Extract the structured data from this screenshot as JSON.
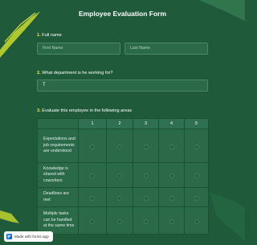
{
  "form": {
    "title": "Employee Evaluation Form",
    "accent_color": "#f1ec2f",
    "background_color": "#1f5a3b"
  },
  "questions": {
    "q1": {
      "number": "1.",
      "label": "Full name",
      "first_placeholder": "First Name",
      "last_placeholder": "Last Name"
    },
    "q2": {
      "number": "2.",
      "label": "What department is he working for?",
      "value": "T"
    },
    "q3": {
      "number": "3.",
      "label": "Evaluate this employee in the following areas",
      "columns": [
        "1",
        "2",
        "3",
        "4",
        "5"
      ],
      "rows": [
        "Expectations and job requirements are understood",
        "Knowledge is shared with coworkers",
        "Deadlines are met",
        "Multiple tasks can be handled at the same time"
      ]
    }
  },
  "badge": {
    "label": "Made with forms app",
    "icon": "forms-app-logo-icon"
  }
}
